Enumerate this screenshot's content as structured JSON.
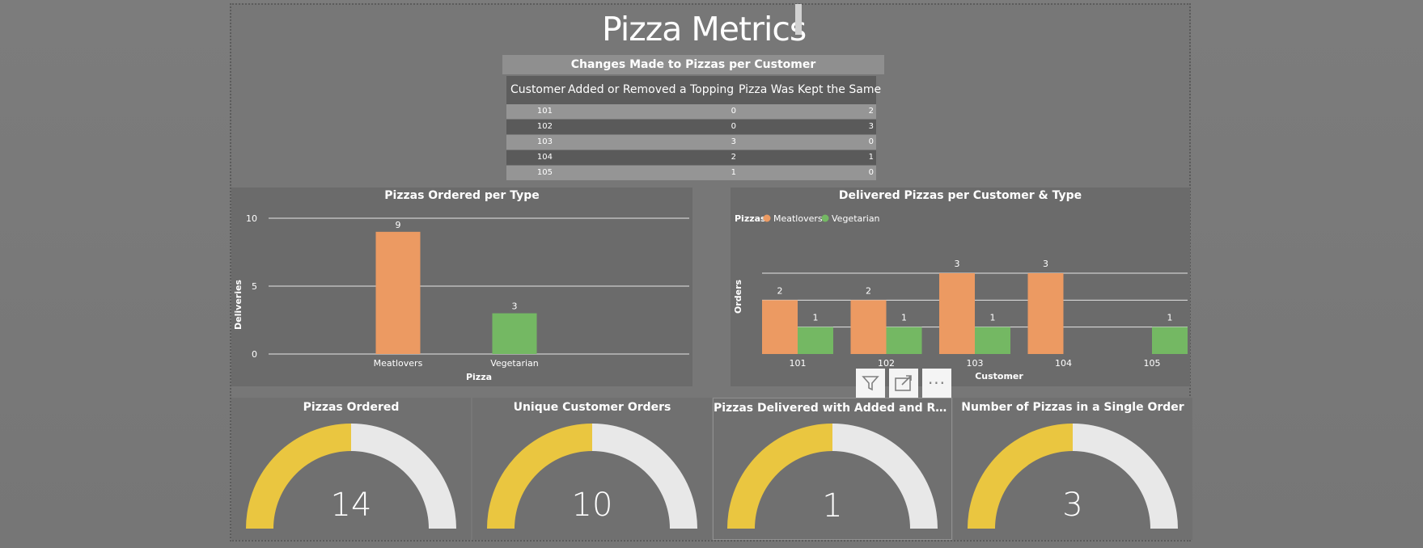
{
  "page": {
    "title": "Pizza Metrics"
  },
  "table": {
    "title": "Changes Made to Pizzas per Customer",
    "columns": [
      "Customer",
      "Added or Removed a Topping",
      "Pizza Was Kept the Same"
    ],
    "rows": [
      [
        "101",
        "0",
        "2"
      ],
      [
        "102",
        "0",
        "3"
      ],
      [
        "103",
        "3",
        "0"
      ],
      [
        "104",
        "2",
        "1"
      ],
      [
        "105",
        "1",
        "0"
      ]
    ]
  },
  "colors": {
    "meatlovers": "#ec9a62",
    "vegetarian": "#74b863",
    "gauge_fill": "#eac640",
    "gauge_empty": "#e8e8e8"
  },
  "chart_data": [
    {
      "type": "bar",
      "title": "Pizzas Ordered per Type",
      "xlabel": "Pizza",
      "ylabel": "Deliveries",
      "categories": [
        "Meatlovers",
        "Vegetarian"
      ],
      "values": [
        9,
        3
      ],
      "data_labels": [
        "9",
        "3"
      ],
      "ylim": [
        0,
        10
      ],
      "yticks": [
        "0",
        "5",
        "10"
      ],
      "grid": true
    },
    {
      "type": "bar",
      "title": "Delivered Pizzas per Customer & Type",
      "xlabel": "Customer",
      "ylabel": "Orders",
      "legend_title": "Pizzas",
      "legend_position": "top-left",
      "categories": [
        "101",
        "102",
        "103",
        "104",
        "105"
      ],
      "series": [
        {
          "name": "Meatlovers",
          "values": [
            2,
            2,
            3,
            3,
            null
          ]
        },
        {
          "name": "Vegetarian",
          "values": [
            1,
            1,
            1,
            null,
            1
          ]
        }
      ],
      "ylim": [
        0,
        3.4
      ],
      "grid": true
    }
  ],
  "toolbar": {
    "filter_icon": "filter-icon",
    "focus_icon": "focus-mode-icon",
    "more_label": "···"
  },
  "gauges": [
    {
      "title": "Pizzas Ordered",
      "value": "14",
      "fraction": 0.5
    },
    {
      "title": "Unique Customer Orders",
      "value": "10",
      "fraction": 0.5
    },
    {
      "title": "Pizzas Delivered with Added and Remo…",
      "value": "1",
      "fraction": 0.5
    },
    {
      "title": "Number of Pizzas in a Single Order",
      "value": "3",
      "fraction": 0.5
    }
  ]
}
